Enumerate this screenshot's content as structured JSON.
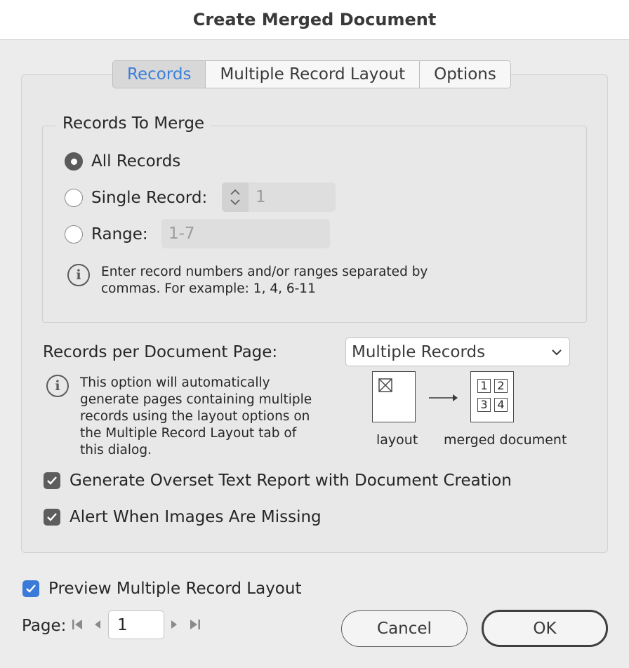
{
  "window": {
    "title": "Create Merged Document"
  },
  "tabs": [
    {
      "label": "Records",
      "active": true
    },
    {
      "label": "Multiple Record Layout",
      "active": false
    },
    {
      "label": "Options",
      "active": false
    }
  ],
  "records_group": {
    "label": "Records To Merge",
    "options": [
      {
        "label": "All Records",
        "selected": true
      },
      {
        "label": "Single Record:",
        "selected": false
      },
      {
        "label": "Range:",
        "selected": false
      }
    ],
    "single_record_value": "1",
    "range_value": "1-7",
    "info_line1": "Enter record numbers and/or ranges separated by",
    "info_line2": "commas. For example: 1, 4, 6-11"
  },
  "per_page": {
    "label": "Records per Document Page:",
    "selected": "Multiple Records",
    "info_lines": [
      "This option will automatically",
      "generate pages containing multiple",
      "records using the layout options on",
      "the Multiple Record Layout tab of",
      "this dialog."
    ],
    "diagram": {
      "layout_label": "layout",
      "merged_label": "merged document",
      "cells": [
        "1",
        "2",
        "3",
        "4"
      ]
    }
  },
  "checks": {
    "overset": {
      "label": "Generate Overset Text Report with Document Creation",
      "checked": true
    },
    "images": {
      "label": "Alert When Images Are Missing",
      "checked": true
    },
    "preview": {
      "label": "Preview Multiple Record Layout",
      "checked": true
    }
  },
  "pager": {
    "label": "Page:",
    "value": "1"
  },
  "buttons": {
    "cancel": "Cancel",
    "ok": "OK"
  },
  "colors": {
    "accent": "#3a7ad9",
    "active_tab_text": "#3c7fd9"
  }
}
